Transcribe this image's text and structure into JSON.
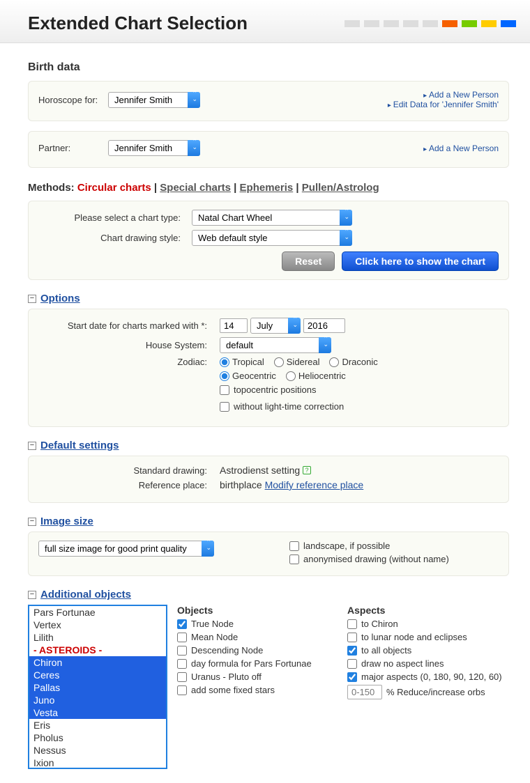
{
  "header": {
    "title": "Extended Chart Selection"
  },
  "colors": [
    "#ddd",
    "#ddd",
    "#ddd",
    "#ddd",
    "#ddd",
    "#f66000",
    "#7c0",
    "#fc0",
    "#06f"
  ],
  "birth": {
    "heading": "Birth data",
    "horoscope_label": "Horoscope for:",
    "horoscope_select": "Jennifer Smith",
    "add_new": "Add a New Person",
    "edit_data": "Edit Data for 'Jennifer Smith'",
    "partner_label": "Partner:",
    "partner_select": "Jennifer Smith"
  },
  "methods": {
    "label": "Methods:",
    "active": "Circular charts",
    "links": [
      "Special charts",
      "Ephemeris",
      "Pullen/Astrolog"
    ]
  },
  "chart": {
    "type_label": "Please select a chart type:",
    "type_value": "Natal Chart Wheel",
    "style_label": "Chart drawing style:",
    "style_value": "Web default style",
    "reset": "Reset",
    "show": "Click here to show the chart"
  },
  "options": {
    "title": "Options",
    "start_label": "Start date for charts marked with *:",
    "day": "14",
    "month": "July",
    "year": "2016",
    "house_label": "House System:",
    "house_value": "default",
    "zodiac_label": "Zodiac:",
    "zodiac1": [
      "Tropical",
      "Sidereal",
      "Draconic"
    ],
    "zodiac2": [
      "Geocentric",
      "Heliocentric"
    ],
    "check1": "topocentric positions",
    "check2": "without light-time correction"
  },
  "defaults": {
    "title": "Default settings",
    "std_label": "Standard drawing:",
    "std_value": "Astrodienst setting",
    "ref_label": "Reference place:",
    "ref_value": "birthplace",
    "ref_link": "Modify reference place"
  },
  "imagesize": {
    "title": "Image size",
    "select": "full size image for good print quality",
    "landscape": "landscape, if possible",
    "anon": "anonymised drawing (without name)"
  },
  "additional": {
    "title": "Additional objects",
    "list": [
      {
        "t": "Pars Fortunae",
        "s": false
      },
      {
        "t": "Vertex",
        "s": false
      },
      {
        "t": "Lilith",
        "s": false
      },
      {
        "t": "- ASTEROIDS -",
        "s": false,
        "h": true
      },
      {
        "t": "Chiron",
        "s": true
      },
      {
        "t": "Ceres",
        "s": true
      },
      {
        "t": "Pallas",
        "s": true
      },
      {
        "t": "Juno",
        "s": true
      },
      {
        "t": "Vesta",
        "s": true
      },
      {
        "t": "Eris",
        "s": false
      },
      {
        "t": "Pholus",
        "s": false
      },
      {
        "t": "Nessus",
        "s": false
      },
      {
        "t": "Ixion",
        "s": false
      }
    ],
    "objects_head": "Objects",
    "objects": [
      {
        "t": "True Node",
        "c": true
      },
      {
        "t": "Mean Node",
        "c": false
      },
      {
        "t": "Descending Node",
        "c": false
      },
      {
        "t": "day formula for Pars Fortunae",
        "c": false
      },
      {
        "t": "Uranus - Pluto off",
        "c": false
      },
      {
        "t": "add some fixed stars",
        "c": false
      }
    ],
    "aspects_head": "Aspects",
    "aspects": [
      {
        "t": "to Chiron",
        "c": false
      },
      {
        "t": "to lunar node and eclipses",
        "c": false
      },
      {
        "t": "to all objects",
        "c": true
      },
      {
        "t": "draw no aspect lines",
        "c": false
      },
      {
        "t": "major aspects (0, 180, 90, 120, 60)",
        "c": true
      }
    ],
    "orb_placeholder": "0-150",
    "orb_label": "% Reduce/increase orbs"
  }
}
